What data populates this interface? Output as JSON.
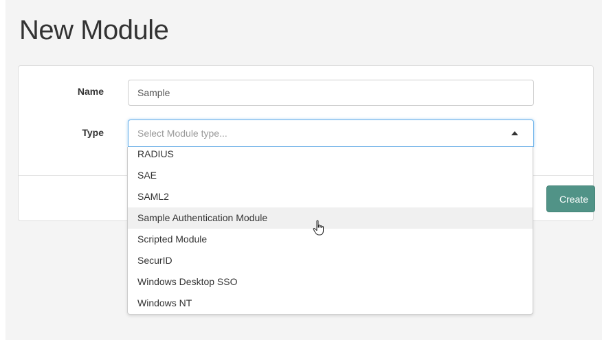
{
  "page": {
    "title": "New Module"
  },
  "form": {
    "name_label": "Name",
    "name_value": "Sample",
    "type_label": "Type",
    "type_placeholder": "Select Module type..."
  },
  "dropdown": {
    "items": [
      "RADIUS",
      "SAE",
      "SAML2",
      "Sample Authentication Module",
      "Scripted Module",
      "SecurID",
      "Windows Desktop SSO",
      "Windows NT"
    ],
    "hovered_item": "Sample Authentication Module"
  },
  "footer": {
    "create_label": "Create"
  },
  "colors": {
    "primary_button": "#519387",
    "focus_border": "#66afe9",
    "hover_row": "#f0f0f0"
  },
  "icons": {
    "select_caret": "caret-up-icon",
    "cursor": "hand-cursor-icon"
  }
}
